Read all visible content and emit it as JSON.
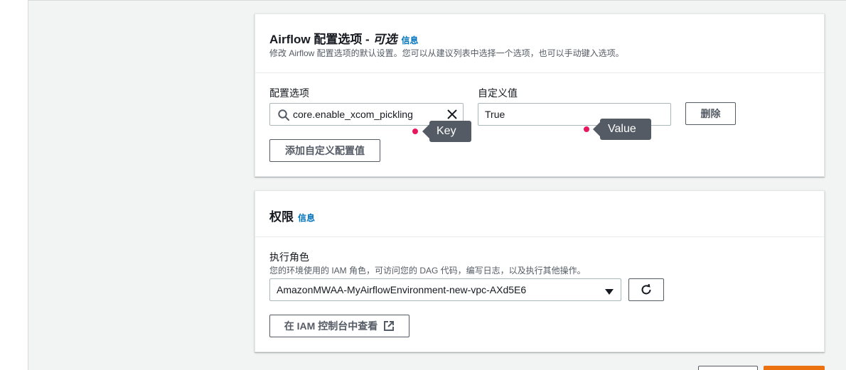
{
  "airflow_config": {
    "title_main": "Airflow 配置选项 - ",
    "title_optional": "可选",
    "info_link": "信息",
    "description": "修改 Airflow 配置选项的默认设置。您可以从建议列表中选择一个选项，也可以手动键入选项。",
    "config_option_label": "配置选项",
    "config_option_value": "core.enable_xcom_pickling",
    "custom_value_label": "自定义值",
    "custom_value_value": "True",
    "remove_button": "删除",
    "add_button": "添加自定义配置值",
    "annotation_key": "Key",
    "annotation_value": "Value"
  },
  "permissions": {
    "title": "权限",
    "info_link": "信息",
    "execution_role_label": "执行角色",
    "execution_role_description": "您的环境使用的 IAM 角色，可访问您的 DAG 代码，编写日志，以及执行其他操作。",
    "execution_role_selected": "AmazonMWAA-MyAirflowEnvironment-new-vpc-AXd5E6",
    "view_in_iam_button": "在 IAM 控制台中查看"
  },
  "icons": {
    "search": "search-icon",
    "clear": "close-icon",
    "dropdown": "caret-down-icon",
    "refresh": "refresh-icon",
    "external": "external-link-icon"
  },
  "colors": {
    "link": "#0073bb",
    "annotation_dot": "#e8175d",
    "annotation_bg": "#545b64",
    "primary_button": "#ec7211"
  }
}
